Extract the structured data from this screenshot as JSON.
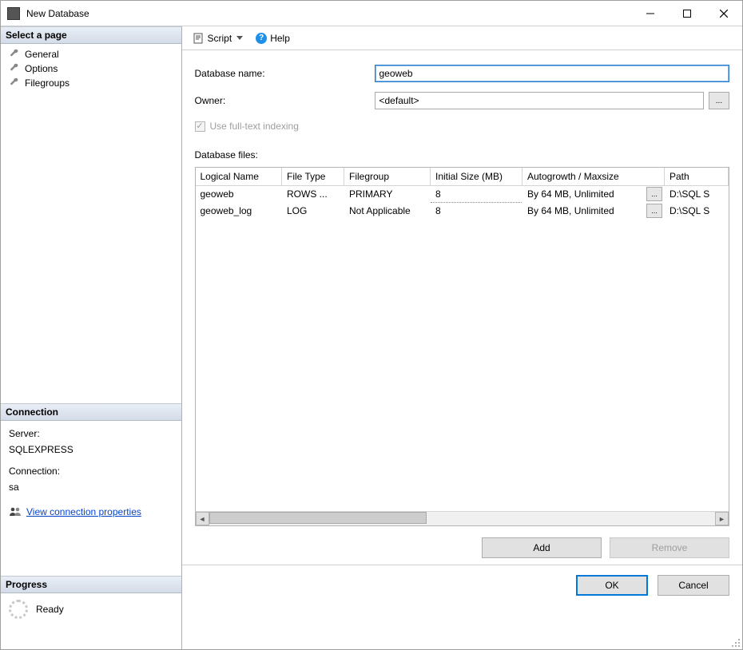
{
  "window": {
    "title": "New Database"
  },
  "pages": {
    "header": "Select a page",
    "items": [
      "General",
      "Options",
      "Filegroups"
    ]
  },
  "toolbar": {
    "script": "Script",
    "help": "Help"
  },
  "form": {
    "dbname_label": "Database name:",
    "dbname_value": "geoweb",
    "owner_label": "Owner:",
    "owner_value": "<default>",
    "fulltext_label": "Use full-text indexing",
    "dbfiles_label": "Database files:"
  },
  "grid": {
    "headers": {
      "logical_name": "Logical Name",
      "file_type": "File Type",
      "filegroup": "Filegroup",
      "initial_size": "Initial Size (MB)",
      "autogrowth": "Autogrowth / Maxsize",
      "path": "Path"
    },
    "rows": [
      {
        "logical_name": "geoweb",
        "file_type": "ROWS ...",
        "filegroup": "PRIMARY",
        "initial_size": "8",
        "autogrowth": "By 64 MB, Unlimited",
        "path": "D:\\SQL S"
      },
      {
        "logical_name": "geoweb_log",
        "file_type": "LOG",
        "filegroup": "Not Applicable",
        "initial_size": "8",
        "autogrowth": "By 64 MB, Unlimited",
        "path": "D:\\SQL S"
      }
    ]
  },
  "grid_buttons": {
    "add": "Add",
    "remove": "Remove"
  },
  "connection": {
    "header": "Connection",
    "server_label": "Server:",
    "server_value": "SQLEXPRESS",
    "connection_label": "Connection:",
    "connection_value": "sa",
    "view_props": "View connection properties"
  },
  "progress": {
    "header": "Progress",
    "status": "Ready"
  },
  "footer": {
    "ok": "OK",
    "cancel": "Cancel"
  }
}
